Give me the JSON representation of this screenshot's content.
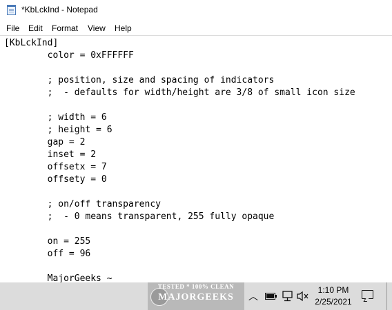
{
  "window": {
    "title": "*KbLckInd - Notepad"
  },
  "menu": {
    "items": [
      "File",
      "Edit",
      "Format",
      "View",
      "Help"
    ]
  },
  "editor": {
    "content": "[KbLckInd]\n        color = 0xFFFFFF\n\n        ; position, size and spacing of indicators\n        ;  - defaults for width/height are 3/8 of small icon size\n\n        ; width = 6\n        ; height = 6\n        gap = 2\n        inset = 2\n        offsetx = 7\n        offsety = 0\n\n        ; on/off transparency\n        ;  - 0 means transparent, 255 fully opaque\n\n        on = 255\n        off = 96\n\n        MajorGeeks ~"
  },
  "watermark": {
    "line1": "TESTED * 100% CLEAN",
    "line2": "MAJORGEEKS"
  },
  "taskbar": {
    "time": "1:10 PM",
    "date": "2/25/2021",
    "icons": [
      "chevron-up-icon",
      "battery-icon",
      "network-icon",
      "volume-muted-icon",
      "notification-icon"
    ]
  }
}
